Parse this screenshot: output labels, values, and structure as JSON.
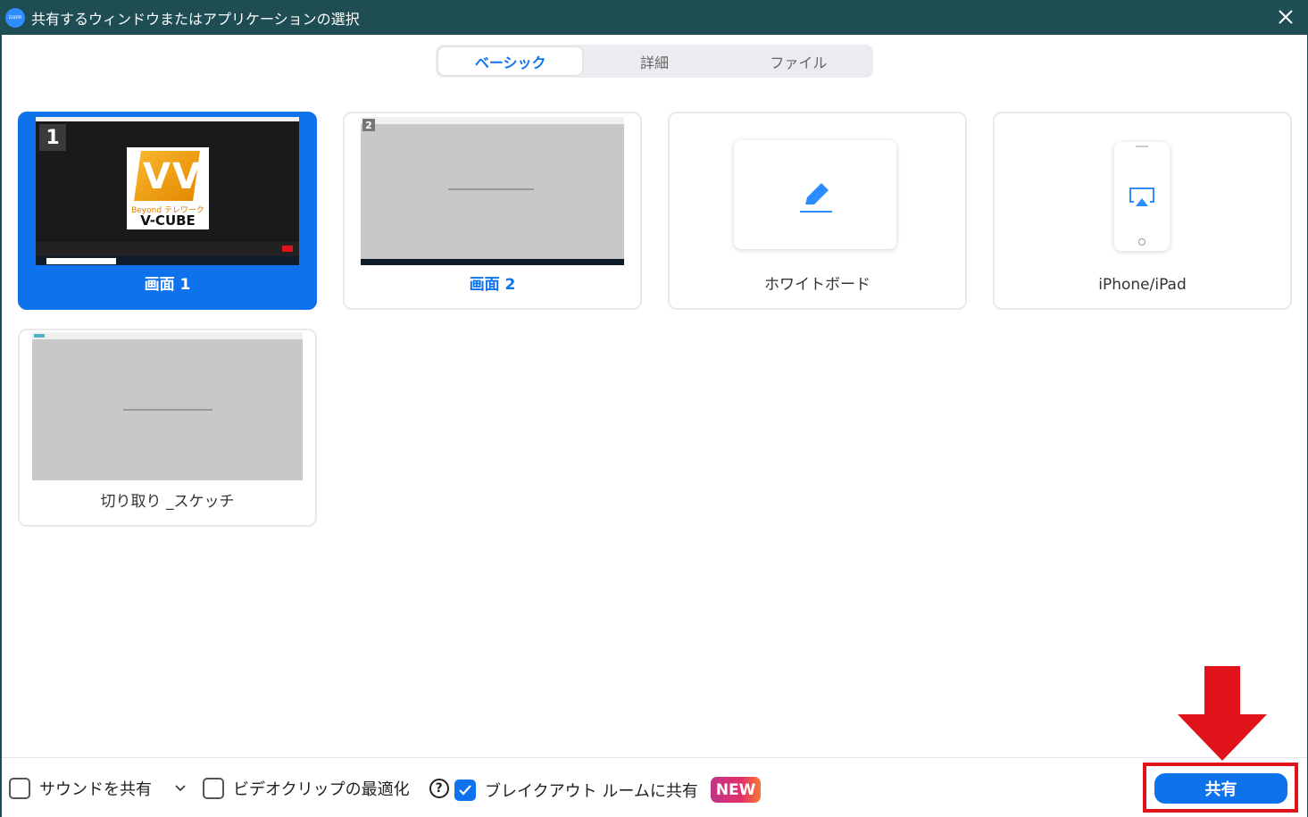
{
  "window": {
    "logo_text": "zoom",
    "title": "共有するウィンドウまたはアプリケーションの選択"
  },
  "tabs": [
    {
      "label": "ベーシック",
      "active": true
    },
    {
      "label": "詳細",
      "active": false
    },
    {
      "label": "ファイル",
      "active": false
    }
  ],
  "cards": {
    "screen1": {
      "label": "画面 1",
      "badge": "1",
      "selected": true,
      "thumb_text_beyond": "Beyond テレワーク",
      "thumb_text_brand": "V-CUBE"
    },
    "screen2": {
      "label": "画面 2",
      "badge": "2",
      "selected": false
    },
    "whiteboard": {
      "label": "ホワイトボード",
      "icon": "pencil-icon"
    },
    "iphone": {
      "label": "iPhone/iPad",
      "icon": "airplay-icon"
    },
    "snip": {
      "label": "切り取り _スケッチ"
    }
  },
  "bottom": {
    "share_sound": {
      "label": "サウンドを共有",
      "checked": false
    },
    "optimize_video": {
      "label": "ビデオクリップの最適化",
      "checked": false
    },
    "help": "?",
    "breakout": {
      "label": "ブレイクアウト ルームに共有",
      "checked": true
    },
    "new_badge": "NEW",
    "share_button": "共有"
  },
  "colors": {
    "accent": "#0e72ed",
    "titlebar": "#1e4d54",
    "highlight": "#e0131b"
  }
}
